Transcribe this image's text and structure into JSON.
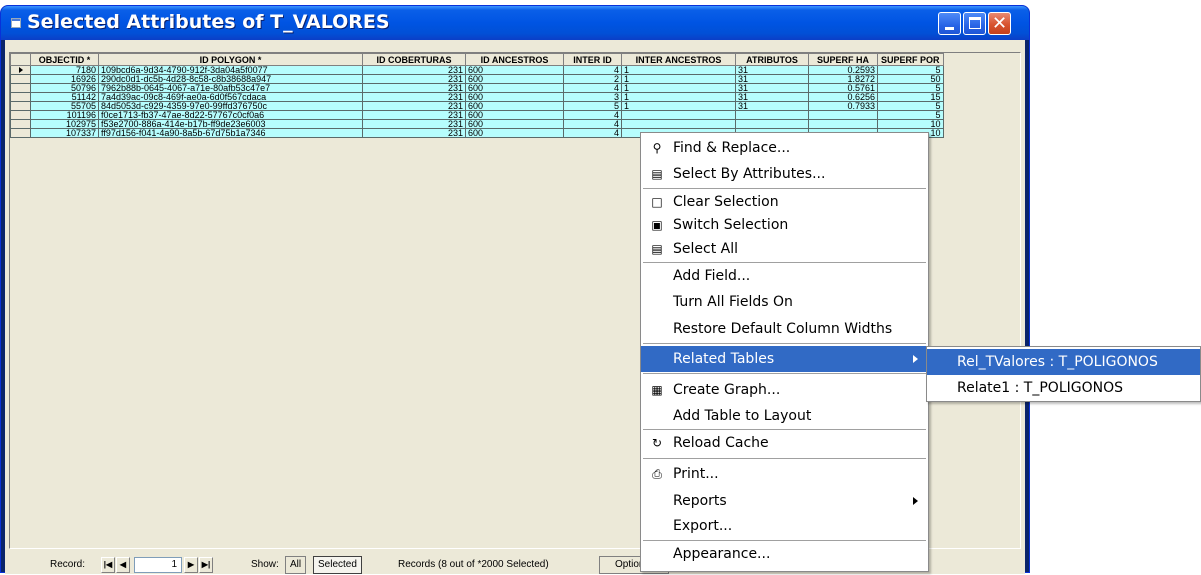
{
  "window": {
    "title": "Selected Attributes of T_VALORES",
    "min_glyph": "",
    "max_glyph": "",
    "close_glyph": "✕"
  },
  "table": {
    "columns": [
      "OBJECTID *",
      "ID POLYGON *",
      "ID COBERTURAS",
      "ID ANCESTROS",
      "INTER ID",
      "INTER ANCESTROS",
      "ATRIBUTOS",
      "SUPERF HA",
      "SUPERF POR"
    ],
    "rows": [
      [
        "7180",
        "109bcd6a-9d34-4790-912f-3da04a5f0077",
        "231",
        "600",
        "4",
        "1",
        "31",
        "0.2593",
        "5"
      ],
      [
        "16926",
        "290dc0d1-dc5b-4d28-8c58-c8b38688a947",
        "231",
        "600",
        "2",
        "1",
        "31",
        "1.8272",
        "50"
      ],
      [
        "50796",
        "7962b88b-0645-4067-a71e-80afb53c47e7",
        "231",
        "600",
        "4",
        "1",
        "31",
        "0.5761",
        "5"
      ],
      [
        "51142",
        "7a4d39ac-09c8-469f-ae0a-6d0f567cdaca",
        "231",
        "600",
        "3",
        "1",
        "31",
        "0.6256",
        "15"
      ],
      [
        "55705",
        "84d5053d-c929-4359-97e0-99ffd376750c",
        "231",
        "600",
        "5",
        "1",
        "31",
        "0.7933",
        "5"
      ],
      [
        "101196",
        "f0ce1713-fb37-47ae-8d22-57767c0cf0a6",
        "231",
        "600",
        "4",
        "",
        "",
        "",
        "5"
      ],
      [
        "102975",
        "f53e2700-886a-414e-b17b-ff9de23e6003",
        "231",
        "600",
        "4",
        "",
        "",
        "",
        "10"
      ],
      [
        "107337",
        "ff97d156-f041-4a90-8a5b-67d75b1a7346",
        "231",
        "600",
        "4",
        "",
        "",
        "",
        "10"
      ]
    ]
  },
  "statusbar": {
    "record_label": "Record:",
    "record_value": "1",
    "nav_first": "|◀",
    "nav_prev": "◀",
    "nav_next": "▶",
    "nav_last": "▶|",
    "show_label": "Show:",
    "show_all": "All",
    "show_selected": "Selected",
    "records_text": "Records (8 out of *2000 Selected)",
    "options_label": "Option"
  },
  "context_menu": {
    "items": [
      {
        "label": "Find & Replace...",
        "icon": "binoculars-icon",
        "glyph": "⚲"
      },
      {
        "label": "Select By Attributes...",
        "icon": "sql-select-icon",
        "glyph": "▤"
      },
      {
        "label": "Clear Selection",
        "icon": "clear-selection-icon",
        "glyph": "□"
      },
      {
        "label": "Switch Selection",
        "icon": "switch-selection-icon",
        "glyph": "▣"
      },
      {
        "label": "Select All",
        "icon": "select-all-icon",
        "glyph": "▤"
      },
      {
        "label": "Add Field...",
        "icon": "",
        "glyph": ""
      },
      {
        "label": "Turn All Fields On",
        "icon": "",
        "glyph": ""
      },
      {
        "label": "Restore Default Column Widths",
        "icon": "",
        "glyph": ""
      },
      {
        "label": "Related Tables",
        "icon": "",
        "glyph": ""
      },
      {
        "label": "Create Graph...",
        "icon": "graph-icon",
        "glyph": "▦"
      },
      {
        "label": "Add Table to Layout",
        "icon": "",
        "glyph": ""
      },
      {
        "label": "Reload Cache",
        "icon": "reload-icon",
        "glyph": "↻"
      },
      {
        "label": "Print...",
        "icon": "printer-icon",
        "glyph": "⎙"
      },
      {
        "label": "Reports",
        "icon": "",
        "glyph": ""
      },
      {
        "label": "Export...",
        "icon": "",
        "glyph": ""
      },
      {
        "label": "Appearance...",
        "icon": "",
        "glyph": ""
      }
    ]
  },
  "submenu": {
    "items": [
      {
        "label": "Rel_TValores : T_POLIGONOS"
      },
      {
        "label": "Relate1 : T_POLIGONOS"
      }
    ]
  },
  "colors": {
    "row_background": "#b6fdfd",
    "menu_highlight": "#316ac5",
    "title_bar": "#0054e3"
  }
}
